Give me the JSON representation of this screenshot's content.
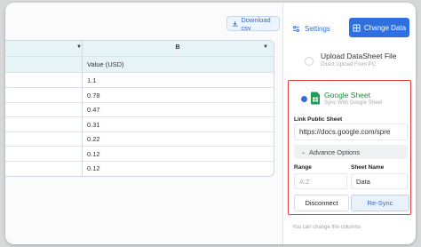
{
  "toolbar": {
    "download_label": "Download csv"
  },
  "sheet": {
    "column_b_header": "B",
    "value_header": "Value (USD)",
    "values": [
      "1.1",
      "0.78",
      "0.47",
      "0.31",
      "0.22",
      "0.12",
      "0.12"
    ]
  },
  "panel": {
    "tab_settings": "Settings",
    "tab_change": "Change Data",
    "upload_title": "Upload DataSheet File",
    "upload_sub": "Direct Upload From PC",
    "gs_title": "Google Sheet",
    "gs_sub": "Sync With Google Sheet",
    "link_label": "Link Public Sheet",
    "link_value": "https://docs.google.com/spre",
    "advance_label": "Advance Options",
    "range_label": "Range",
    "range_placeholder": "A:Z",
    "sheet_name_label": "Sheet Name",
    "sheet_name_value": "Data",
    "disconnect_label": "Disconnect",
    "resync_label": "Re-Sync",
    "footer_text": "You can change the columns"
  },
  "colors": {
    "accent": "#2f6fe0",
    "highlight_border": "#e23c3c",
    "sheet_green": "#1f8f3e"
  }
}
